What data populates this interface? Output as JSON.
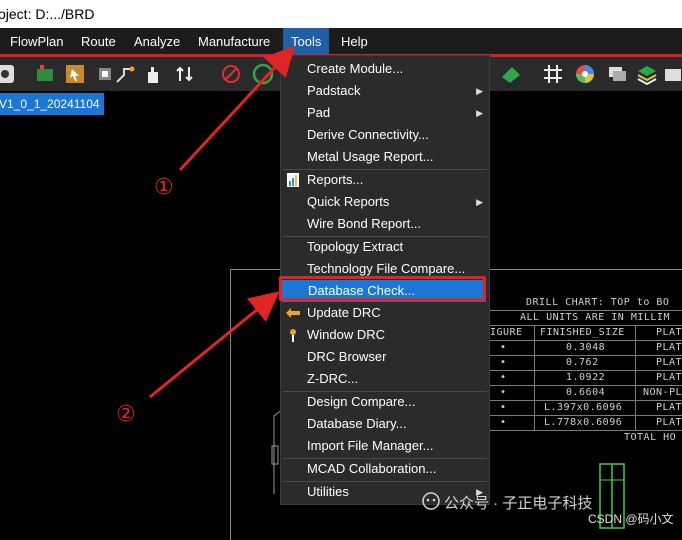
{
  "title_bar": {
    "text": "oject: D:.../BRD"
  },
  "menu": [
    {
      "label": "FlowPlan"
    },
    {
      "label": "Route"
    },
    {
      "label": "Analyze"
    },
    {
      "label": "Manufacture"
    },
    {
      "label": "Tools"
    },
    {
      "label": "Help"
    }
  ],
  "active_menu": "Tools",
  "toolbar_icons": [
    "pin-icon",
    "package-icon",
    "chip-select-icon",
    "chip-icon",
    "route-icon",
    "hand-icon",
    "swap-icon",
    "no-entry-icon",
    "circle-icon",
    "board-icon",
    "grid-icon",
    "color-wheel-icon",
    "layers-icon",
    "stack-icon"
  ],
  "doc_tab": {
    "label": "V1_0_1_20241104"
  },
  "dropdown": {
    "items": [
      {
        "label": "Create Module...",
        "submenu": false
      },
      {
        "label": "Padstack",
        "submenu": true
      },
      {
        "label": "Pad",
        "submenu": true
      },
      {
        "label": "Derive Connectivity...",
        "submenu": false
      },
      {
        "label": "Metal Usage Report...",
        "submenu": false
      },
      {
        "label": "Reports...",
        "submenu": false,
        "icon": "report-icon"
      },
      {
        "label": "Quick Reports",
        "submenu": true
      },
      {
        "label": "Wire Bond Report...",
        "submenu": false
      },
      {
        "label": "Topology Extract",
        "submenu": false
      },
      {
        "label": "Technology File Compare...",
        "submenu": false
      },
      {
        "label": "Database Check...",
        "submenu": false,
        "highlighted": true
      },
      {
        "label": "Update DRC",
        "submenu": false,
        "icon": "update-drc-icon"
      },
      {
        "label": "Window DRC",
        "submenu": false,
        "icon": "window-drc-icon"
      },
      {
        "label": "DRC Browser",
        "submenu": false
      },
      {
        "label": "Z-DRC...",
        "submenu": false
      },
      {
        "label": "Design Compare...",
        "submenu": false
      },
      {
        "label": "Database Diary...",
        "submenu": false
      },
      {
        "label": "Import File Manager...",
        "submenu": false
      },
      {
        "label": "MCAD Collaboration...",
        "submenu": false
      },
      {
        "label": "Utilities",
        "submenu": true
      }
    ]
  },
  "annotations": {
    "step1": "①",
    "step2": "②"
  },
  "drill_chart": {
    "title": "DRILL CHART: TOP to BO",
    "units": "ALL UNITS ARE IN MILLIM",
    "headers": [
      "IGURE",
      "FINISHED_SIZE",
      "PLAT"
    ],
    "rows": [
      {
        "figure": "•",
        "size": "0.3048",
        "plated": "PLAT"
      },
      {
        "figure": "•",
        "size": "0.762",
        "plated": "PLAT"
      },
      {
        "figure": "•",
        "size": "1.0922",
        "plated": "PLAT"
      },
      {
        "figure": "•",
        "size": "0.6604",
        "plated": "NON-PL"
      },
      {
        "figure": "•",
        "size": "L.397x0.6096",
        "plated": "PLAT"
      },
      {
        "figure": "•",
        "size": "L.778x0.6096",
        "plated": "PLAT"
      }
    ],
    "total": "TOTAL HO"
  },
  "watermark": {
    "text": "公众号 · 子正电子科技"
  },
  "csdn": {
    "text": "CSDN @码小文"
  },
  "colors": {
    "menu_bg": "#1c1c1c",
    "highlight": "#1a78d4",
    "annotation_red": "#e12525"
  }
}
